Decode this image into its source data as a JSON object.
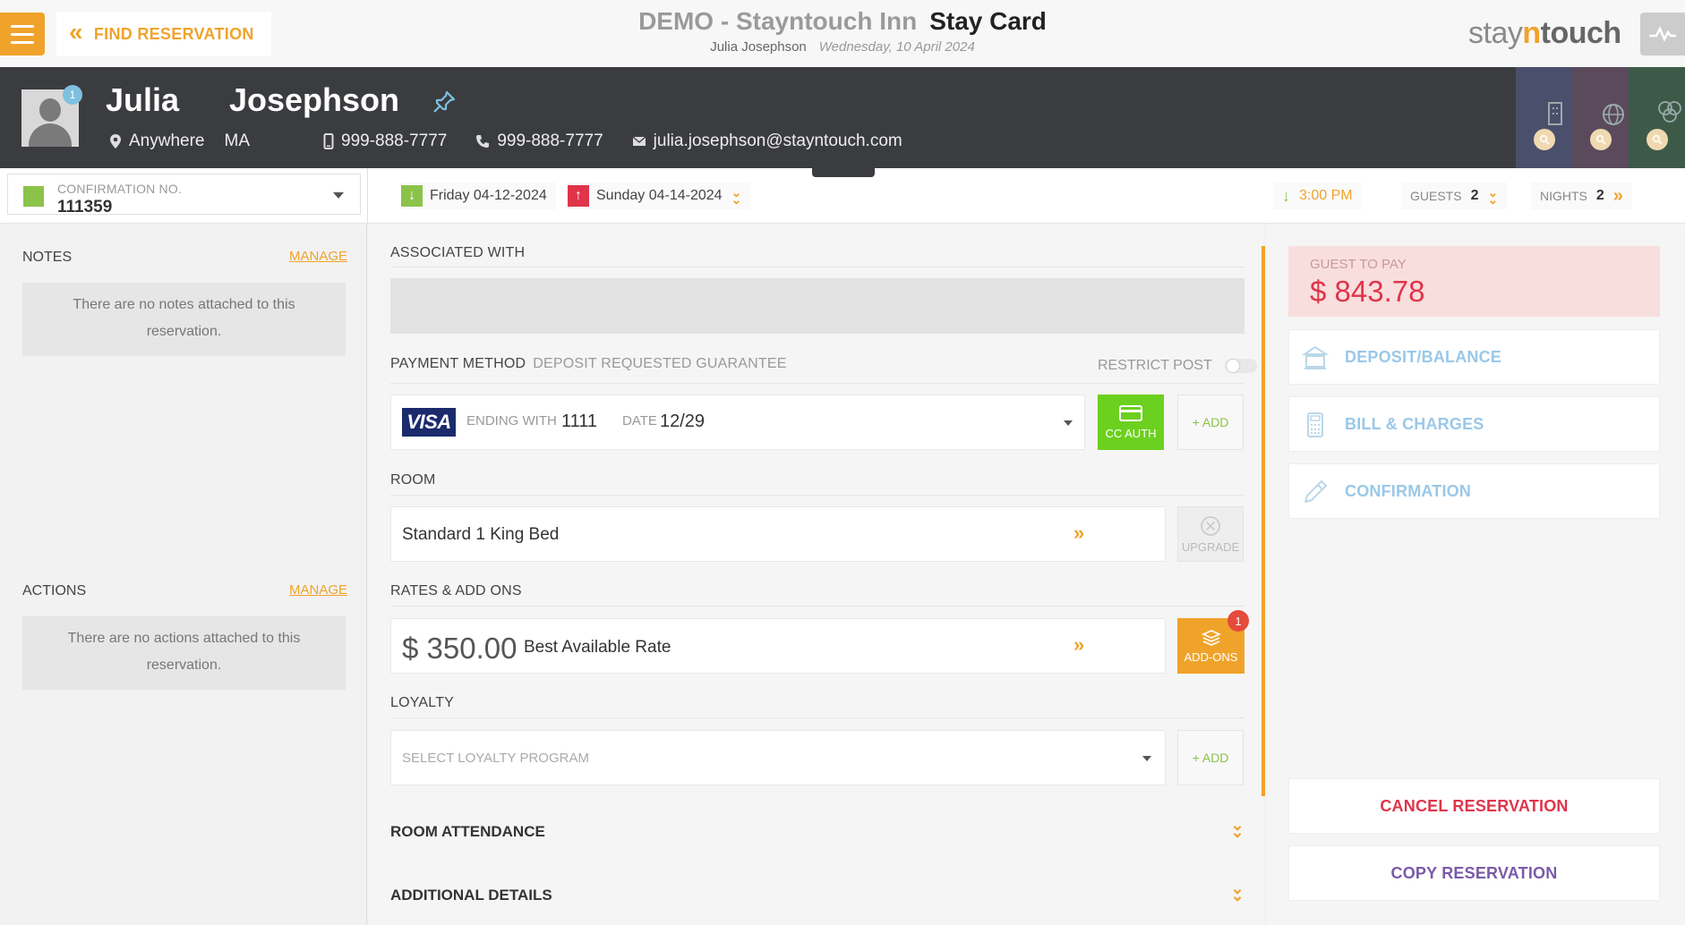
{
  "header": {
    "find_reservation": "FIND RESERVATION",
    "hotel_name": "DEMO - Stayntouch Inn",
    "page_title": "Stay Card",
    "user_name": "Julia Josephson",
    "business_date": "Wednesday, 10 April 2024",
    "brand_prefix": "stay",
    "brand_mid": "n",
    "brand_suffix": "touch"
  },
  "guest": {
    "first_name": "Julia",
    "last_name": "Josephson",
    "avatar_badge": "1",
    "city": "Anywhere",
    "state": "MA",
    "phone": "999-888-7777",
    "mobile": "999-888-7777",
    "email": "julia.josephson@stayntouch.com",
    "tile_colors": [
      "#4a4f6b",
      "#5a4a5c",
      "#3d5a48"
    ]
  },
  "reservation": {
    "confirmation_label": "CONFIRMATION NO.",
    "confirmation_number": "111359",
    "arrival_date": "Friday 04-12-2024",
    "departure_date": "Sunday 04-14-2024",
    "arrival_time": "3:00 PM",
    "guests_label": "GUESTS",
    "guests_value": "2",
    "nights_label": "NIGHTS",
    "nights_value": "2"
  },
  "sidebar": {
    "notes_label": "NOTES",
    "notes_manage": "MANAGE",
    "notes_empty_line1": "There are no notes attached to this",
    "notes_empty_line2": "reservation.",
    "actions_label": "ACTIONS",
    "actions_manage": "MANAGE",
    "actions_empty_line1": "There are no actions attached to this",
    "actions_empty_line2": "reservation."
  },
  "main": {
    "associated_label": "ASSOCIATED WITH",
    "payment_label": "PAYMENT METHOD",
    "payment_sub": "DEPOSIT REQUESTED GUARANTEE",
    "restrict_post": "RESTRICT POST",
    "card_brand": "VISA",
    "ending_label": "ENDING WITH",
    "ending_value": "1111",
    "date_label": "DATE",
    "date_value": "12/29",
    "cc_auth": "CC AUTH",
    "add_label": "+ ADD",
    "room_label": "ROOM",
    "room_type": "Standard 1 King Bed",
    "upgrade": "UPGRADE",
    "rates_label": "RATES & ADD ONS",
    "rate_amount": "$ 350.00",
    "rate_name": "Best Available Rate",
    "addons": "ADD-ONS",
    "addons_count": "1",
    "loyalty_label": "LOYALTY",
    "loyalty_placeholder": "SELECT LOYALTY PROGRAM",
    "loyalty_add": "+ ADD",
    "room_attendance": "ROOM ATTENDANCE",
    "additional_details": "ADDITIONAL DETAILS"
  },
  "right": {
    "guest_to_pay_label": "GUEST TO PAY",
    "guest_to_pay_amount": "$ 843.78",
    "deposit_balance": "DEPOSIT/BALANCE",
    "bill_charges": "BILL & CHARGES",
    "confirmation": "CONFIRMATION",
    "cancel_reservation": "CANCEL RESERVATION",
    "copy_reservation": "COPY RESERVATION"
  },
  "colors": {
    "accent": "#f0a32b",
    "cancel": "#e0344a",
    "copy": "#7a5aa8",
    "cc_auth": "#6cd01f",
    "due_bg": "#f9dede"
  }
}
